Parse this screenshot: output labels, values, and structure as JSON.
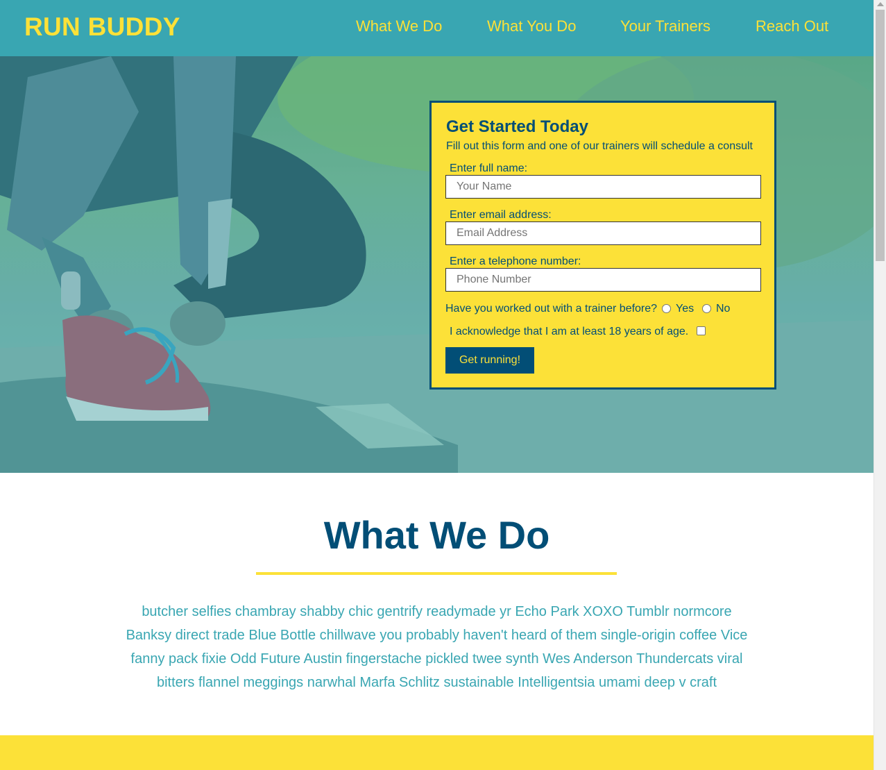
{
  "header": {
    "brand": "RUN BUDDY",
    "nav": [
      "What We Do",
      "What You Do",
      "Your Trainers",
      "Reach Out"
    ]
  },
  "form": {
    "title": "Get Started Today",
    "subtitle": "Fill out this form and one of our trainers will schedule a consult",
    "name_label": "Enter full name:",
    "name_placeholder": "Your Name",
    "email_label": "Enter email address:",
    "email_placeholder": "Email Address",
    "phone_label": "Enter a telephone number:",
    "phone_placeholder": "Phone Number",
    "trainer_question": "Have you worked out with a trainer before?",
    "yes_label": "Yes",
    "no_label": "No",
    "age_ack": "I acknowledge that I am at least 18 years of age.",
    "submit_label": "Get running!"
  },
  "what_we_do": {
    "title": "What We Do",
    "body": "butcher selfies chambray shabby chic gentrify readymade yr Echo Park XOXO Tumblr normcore Banksy direct trade Blue Bottle chillwave you probably haven't heard of them single-origin coffee Vice fanny pack fixie Odd Future Austin fingerstache pickled twee synth Wes Anderson Thundercats viral bitters flannel meggings narwhal Marfa Schlitz sustainable Intelligentsia umami deep v craft"
  },
  "colors": {
    "primary": "#39a6b2",
    "accent": "#fce138",
    "dark": "#024e76"
  }
}
